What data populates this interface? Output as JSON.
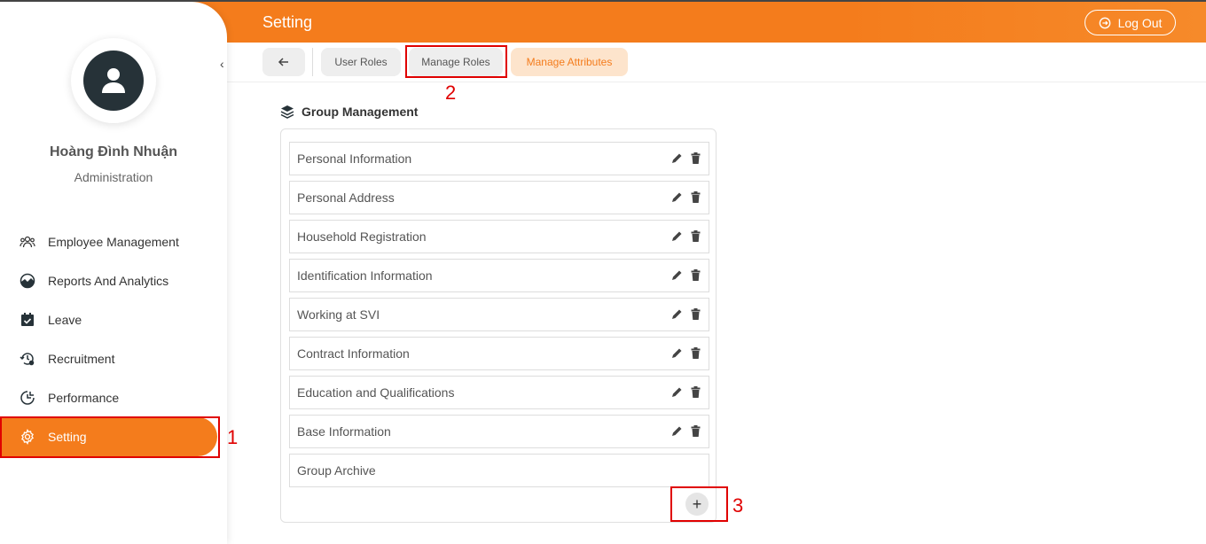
{
  "header": {
    "title": "Setting",
    "logout_label": "Log Out"
  },
  "profile": {
    "name": "Hoàng Đình Nhuận",
    "role": "Administration"
  },
  "sidebar": {
    "items": [
      {
        "label": "Employee Management",
        "icon": "people-icon"
      },
      {
        "label": "Reports And Analytics",
        "icon": "chart-icon"
      },
      {
        "label": "Leave",
        "icon": "calendar-check-icon"
      },
      {
        "label": "Recruitment",
        "icon": "recruitment-icon"
      },
      {
        "label": "Performance",
        "icon": "performance-icon"
      },
      {
        "label": "Setting",
        "icon": "gear-icon",
        "active": true
      }
    ]
  },
  "tabs": {
    "user_roles": "User Roles",
    "manage_roles": "Manage Roles",
    "manage_attributes": "Manage Attributes"
  },
  "group_management": {
    "title": "Group Management",
    "items": [
      {
        "label": "Personal Information",
        "editable": true
      },
      {
        "label": "Personal Address",
        "editable": true
      },
      {
        "label": "Household Registration",
        "editable": true
      },
      {
        "label": "Identification Information",
        "editable": true
      },
      {
        "label": "Working at SVI",
        "editable": true
      },
      {
        "label": "Contract Information",
        "editable": true
      },
      {
        "label": "Education and Qualifications",
        "editable": true
      },
      {
        "label": "Base Information",
        "editable": true
      },
      {
        "label": "Group Archive",
        "editable": false
      }
    ],
    "add_label": "+"
  },
  "annotations": [
    "1",
    "2",
    "3"
  ],
  "colors": {
    "accent": "#f47c1c",
    "annotation": "#e00000"
  }
}
